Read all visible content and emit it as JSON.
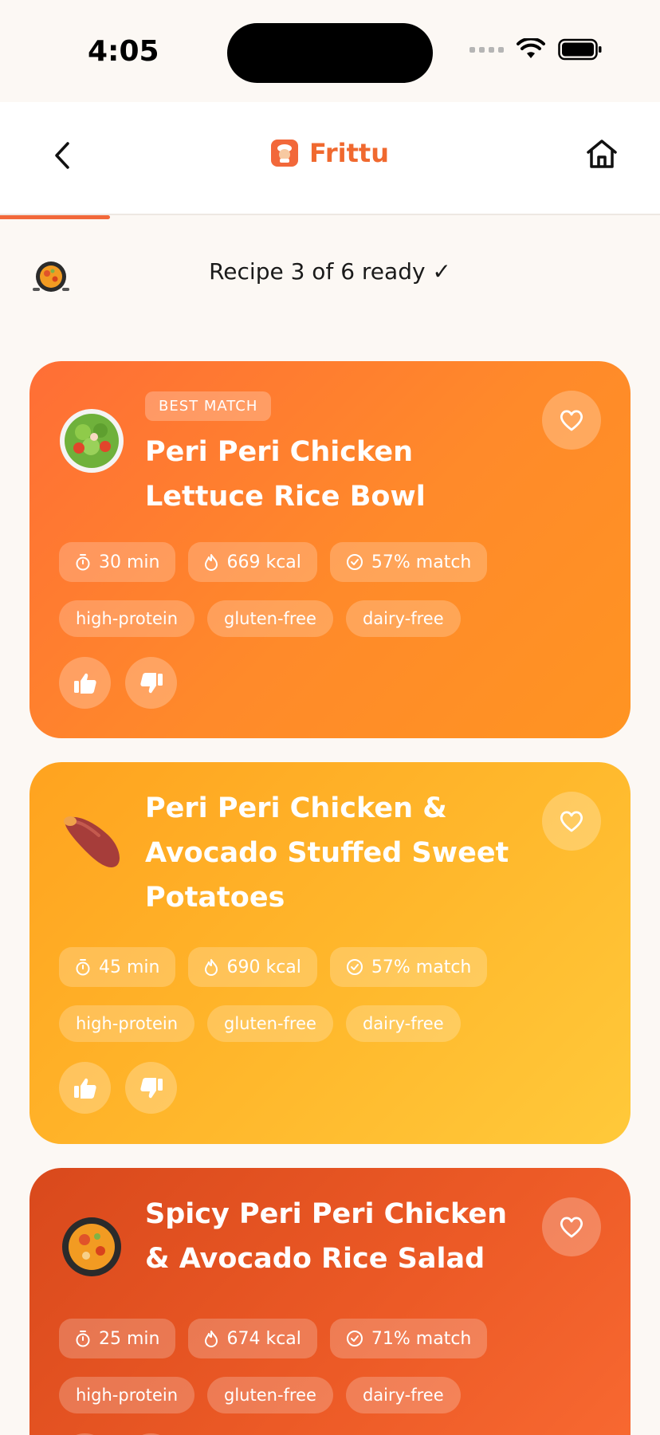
{
  "status_bar": {
    "time": "4:05"
  },
  "header": {
    "brand": "Frittu",
    "back_icon": "chevron-left-icon",
    "home_icon": "home-icon"
  },
  "progress": {
    "fraction": 0.167
  },
  "status": {
    "text": "Recipe 3 of 6 ready ✓"
  },
  "cards": [
    {
      "badge": "BEST MATCH",
      "title": "Peri Peri Chicken Lettuce Rice Bowl",
      "image": "salad-bowl",
      "time": "30 min",
      "kcal": "669 kcal",
      "match": "57% match",
      "tags": [
        "high-protein",
        "gluten-free",
        "dairy-free"
      ]
    },
    {
      "badge": "",
      "title": "Peri Peri Chicken & Avocado Stuffed Sweet Potatoes",
      "image": "sweet-potato",
      "time": "45 min",
      "kcal": "690 kcal",
      "match": "57% match",
      "tags": [
        "high-protein",
        "gluten-free",
        "dairy-free"
      ]
    },
    {
      "badge": "",
      "title": "Spicy Peri Peri Chicken & Avocado Rice Salad",
      "image": "paella-pan",
      "time": "25 min",
      "kcal": "674 kcal",
      "match": "71% match",
      "tags": [
        "high-protein",
        "gluten-free",
        "dairy-free"
      ]
    }
  ],
  "colors": {
    "accent": "#f2683a",
    "brand_text": "#f0692f",
    "background": "#fcf8f4"
  }
}
